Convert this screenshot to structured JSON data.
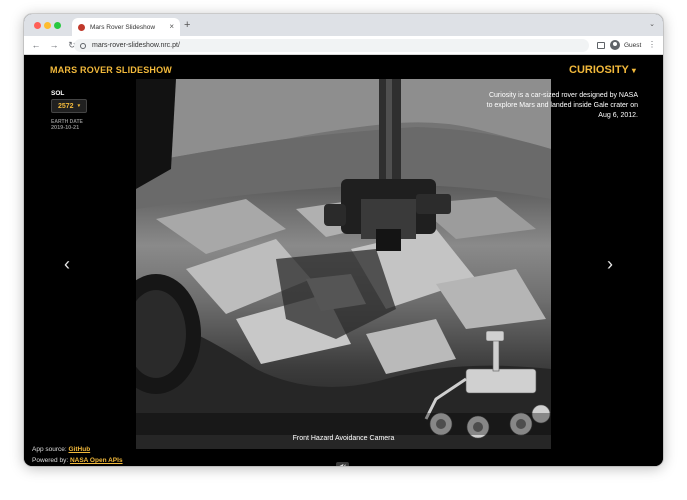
{
  "browser": {
    "tab_title": "Mars Rover Slideshow",
    "tab_close": "×",
    "new_tab": "+",
    "tab_menu": "⌄",
    "url": "mars-rover-slideshow.nrc.pt/",
    "profile_label": "Guest",
    "nav": {
      "back": "←",
      "forward": "→",
      "reload": "↻",
      "menu": "⋮"
    }
  },
  "site": {
    "title": "MARS ROVER SLIDESHOW",
    "rover_name": "CURIOSITY",
    "caret": "▾",
    "sol_label": "SOL",
    "sol_value": "2572",
    "earth_date_label": "EARTH DATE",
    "earth_date": "2019-10-21",
    "description": "Curiosity is a car-sized rover designed by NASA to explore Mars and landed inside Gale crater on Aug 6, 2012.",
    "camera_caption": "Front Hazard Avoidance Camera",
    "prev_arrow": "‹",
    "next_arrow": "›",
    "mute_icon": "◀×"
  },
  "footer": {
    "source_prefix": "App source:",
    "source_link": "GitHub",
    "powered_prefix": "Powered by:",
    "powered_link": "NASA Open APIs"
  },
  "colors": {
    "accent": "#f2b93b",
    "page_bg": "#000000",
    "chrome_bg": "#dee1e6"
  }
}
